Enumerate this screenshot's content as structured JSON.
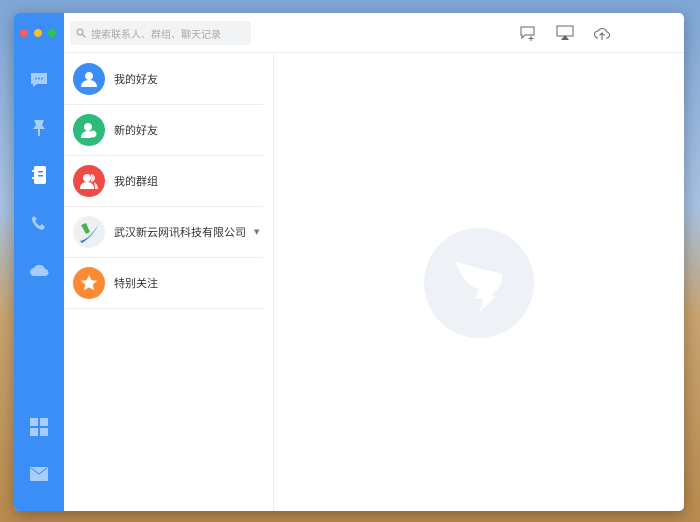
{
  "search": {
    "placeholder": "搜索联系人、群组、聊天记录"
  },
  "sidebar": {
    "items": [
      "chat",
      "ding",
      "contacts",
      "phone",
      "cloud",
      "apps",
      "mail"
    ]
  },
  "contacts": {
    "items": [
      {
        "label": "我的好友",
        "color": "#3a8ef6",
        "icon": "person-icon"
      },
      {
        "label": "新的好友",
        "color": "#2dbb7c",
        "icon": "person-add-icon"
      },
      {
        "label": "我的群组",
        "color": "#ef4b45",
        "icon": "group-icon"
      },
      {
        "label": "武汉新云网讯科技有限公司",
        "color": "#eef1f3",
        "icon": "company-logo"
      },
      {
        "label": "特别关注",
        "color": "#fb8a35",
        "icon": "star-icon"
      }
    ]
  }
}
